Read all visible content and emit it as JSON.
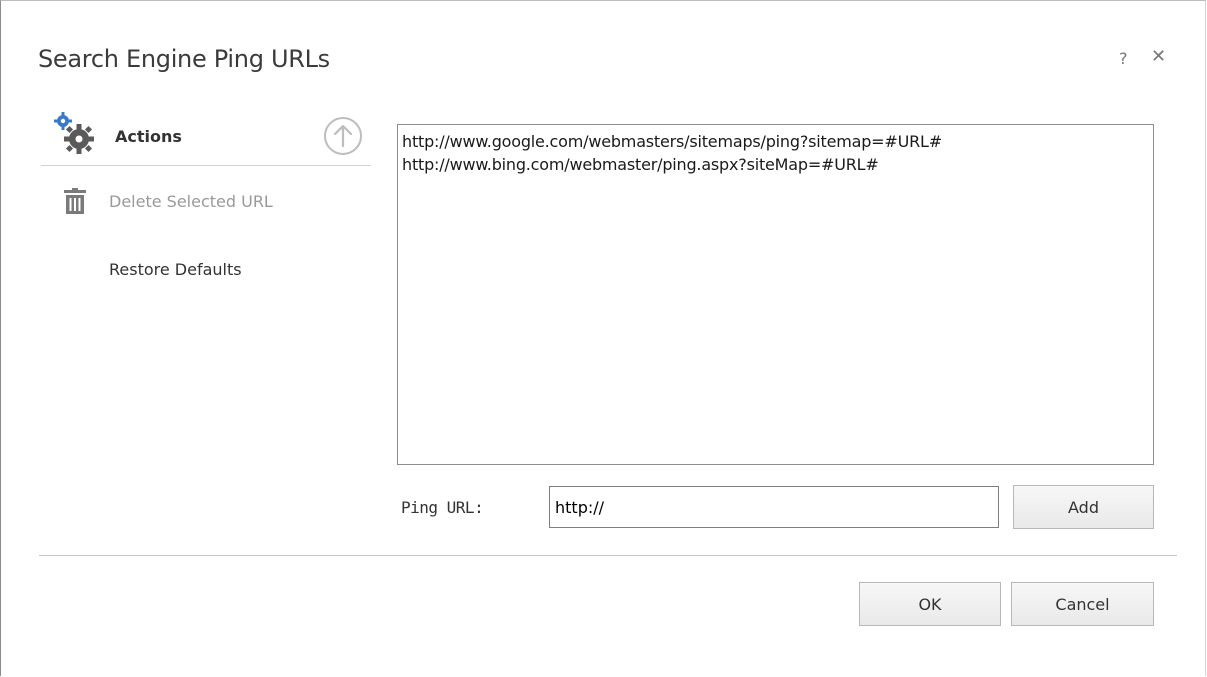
{
  "dialog": {
    "title": "Search Engine Ping URLs",
    "help_label": "?",
    "close_label": "✕"
  },
  "actions": {
    "header": "Actions",
    "delete_label": "Delete Selected URL",
    "restore_label": "Restore Defaults"
  },
  "url_list": [
    "http://www.google.com/webmasters/sitemaps/ping?sitemap=#URL#",
    "http://www.bing.com/webmaster/ping.aspx?siteMap=#URL#"
  ],
  "ping": {
    "label": "Ping URL:",
    "value": "http://",
    "add_label": "Add"
  },
  "footer": {
    "ok_label": "OK",
    "cancel_label": "Cancel"
  },
  "colors": {
    "gear_blue": "#3a78c8",
    "gear_gray": "#5a5a5a",
    "disabled_text": "#9a9a9a"
  }
}
